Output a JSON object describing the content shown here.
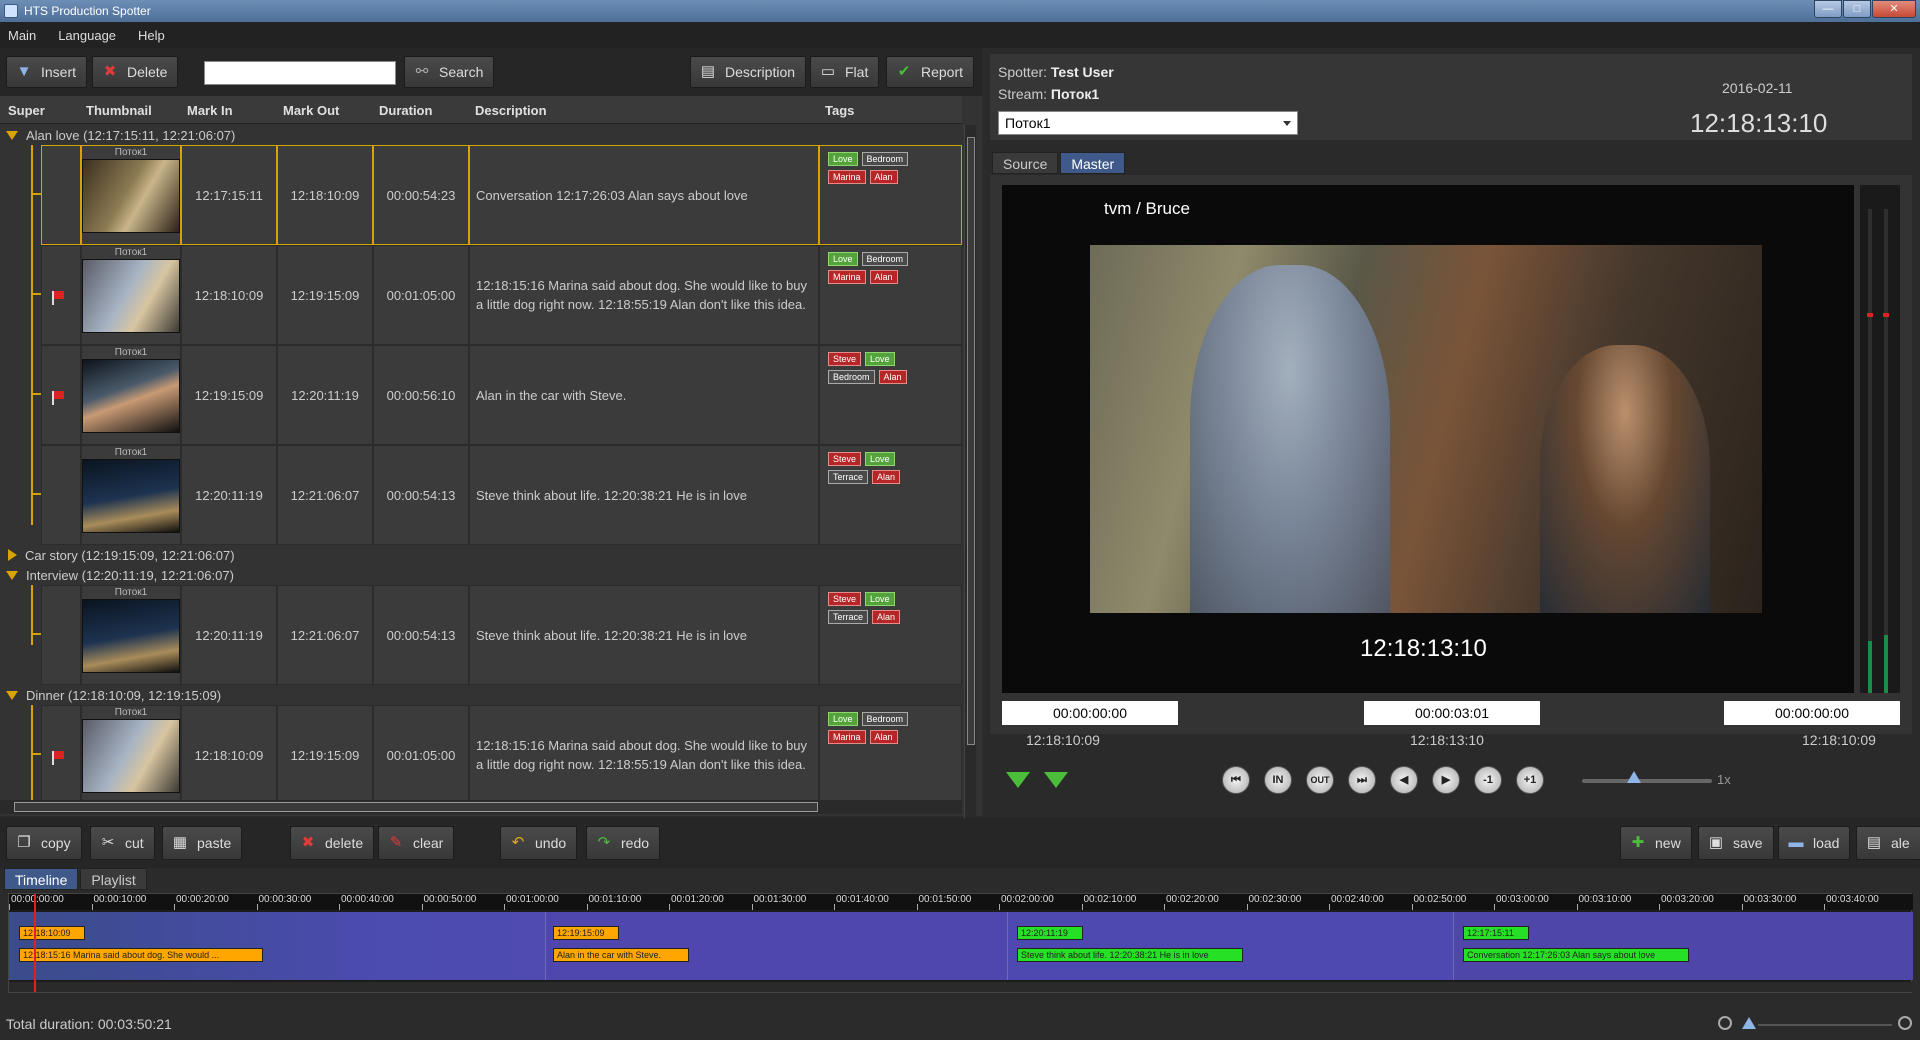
{
  "window": {
    "title": "HTS Production Spotter",
    "controls": [
      "—",
      "□",
      "✕"
    ]
  },
  "menu": [
    "Main",
    "Language",
    "Help"
  ],
  "toolbar": {
    "insert": "Insert",
    "delete": "Delete",
    "search_value": "",
    "search": "Search",
    "description": "Description",
    "flat": "Flat",
    "report": "Report"
  },
  "columns": [
    "Super",
    "Thumbnail",
    "Mark In",
    "Mark Out",
    "Duration",
    "Description",
    "Tags"
  ],
  "groups": [
    {
      "label": "Alan love (12:17:15:11, 12:21:06:07)",
      "open": true
    },
    {
      "label": "Car story (12:19:15:09, 12:21:06:07)",
      "open": false
    },
    {
      "label": "Interview (12:20:11:19, 12:21:06:07)",
      "open": true
    },
    {
      "label": "Dinner  (12:18:10:09, 12:19:15:09)",
      "open": true
    }
  ],
  "clips": [
    {
      "thumb_label": "Поток1",
      "mark_in": "12:17:15:11",
      "mark_out": "12:18:10:09",
      "duration": "00:00:54:23",
      "description": "Conversation 12:17:26:03 Alan says about love",
      "tags": [
        [
          "Love",
          "green"
        ],
        [
          "Bedroom",
          "gray"
        ],
        [
          "Marina",
          "red"
        ],
        [
          "Alan",
          "red"
        ]
      ],
      "flag": false,
      "selected": true
    },
    {
      "thumb_label": "Поток1",
      "mark_in": "12:18:10:09",
      "mark_out": "12:19:15:09",
      "duration": "00:01:05:00",
      "description": "12:18:15:16 Marina said about dog. She would like to buy a little dog right now. 12:18:55:19 Alan don't like this idea.",
      "tags": [
        [
          "Love",
          "green"
        ],
        [
          "Bedroom",
          "gray"
        ],
        [
          "Marina",
          "red"
        ],
        [
          "Alan",
          "red"
        ]
      ],
      "flag": true,
      "selected": false
    },
    {
      "thumb_label": "Поток1",
      "mark_in": "12:19:15:09",
      "mark_out": "12:20:11:19",
      "duration": "00:00:56:10",
      "description": "Alan in the car with Steve.",
      "tags": [
        [
          "Steve",
          "red"
        ],
        [
          "Love",
          "green"
        ],
        [
          "Bedroom",
          "gray"
        ],
        [
          "Alan",
          "red"
        ]
      ],
      "flag": true,
      "selected": false
    },
    {
      "thumb_label": "Поток1",
      "mark_in": "12:20:11:19",
      "mark_out": "12:21:06:07",
      "duration": "00:00:54:13",
      "description": "Steve think about life. 12:20:38:21 He is in love",
      "tags": [
        [
          "Steve",
          "red"
        ],
        [
          "Love",
          "green"
        ],
        [
          "Terrace",
          "gray"
        ],
        [
          "Alan",
          "red"
        ]
      ],
      "flag": false,
      "selected": false
    },
    {
      "thumb_label": "Поток1",
      "mark_in": "12:20:11:19",
      "mark_out": "12:21:06:07",
      "duration": "00:00:54:13",
      "description": "Steve think about life. 12:20:38:21 He is in love",
      "tags": [
        [
          "Steve",
          "red"
        ],
        [
          "Love",
          "green"
        ],
        [
          "Terrace",
          "gray"
        ],
        [
          "Alan",
          "red"
        ]
      ],
      "flag": false,
      "selected": false
    },
    {
      "thumb_label": "Поток1",
      "mark_in": "12:18:10:09",
      "mark_out": "12:19:15:09",
      "duration": "00:01:05:00",
      "description": "12:18:15:16 Marina said about dog. She would like to buy a little dog right now. 12:18:55:19 Alan don't like this idea.",
      "tags": [
        [
          "Love",
          "green"
        ],
        [
          "Bedroom",
          "gray"
        ],
        [
          "Marina",
          "red"
        ],
        [
          "Alan",
          "red"
        ]
      ],
      "flag": true,
      "selected": false
    }
  ],
  "spotter": {
    "spotter_label": "Spotter:",
    "spotter_name": "Test User",
    "stream_label": "Stream:",
    "stream_name": "Поток1",
    "stream_selected": "Поток1",
    "date": "2016-02-11",
    "clock": "12:18:13:10"
  },
  "video_tabs": [
    "Source",
    "Master"
  ],
  "video": {
    "channel": "tvm / Bruce",
    "timecode": "12:18:13:10",
    "tc_in": "00:00:00:00",
    "tc_mid": "00:00:03:01",
    "tc_out": "00:00:00:00",
    "label_left": "12:18:10:09",
    "label_mid": "12:18:13:10",
    "label_right": "12:18:10:09"
  },
  "transport": {
    "buttons": [
      "⏮",
      "IN",
      "OUT",
      "⏭",
      "◀",
      "▶",
      "-1",
      "+1"
    ],
    "speed_label": "1x",
    "speed_value": 0.4
  },
  "edit": {
    "copy": "copy",
    "cut": "cut",
    "paste": "paste",
    "delete": "delete",
    "clear": "clear",
    "undo": "undo",
    "redo": "redo",
    "new": "new",
    "save": "save",
    "load": "load",
    "ale": "ale"
  },
  "timeline_tabs": [
    "Timeline",
    "Playlist"
  ],
  "ruler": [
    "00:00:00:00",
    "00:00:10:00",
    "00:00:20:00",
    "00:00:30:00",
    "00:00:40:00",
    "00:00:50:00",
    "00:01:00:00",
    "00:01:10:00",
    "00:01:20:00",
    "00:01:30:00",
    "00:01:40:00",
    "00:01:50:00",
    "00:02:00:00",
    "00:02:10:00",
    "00:02:20:00",
    "00:02:30:00",
    "00:02:40:00",
    "00:02:50:00",
    "00:03:00:00",
    "00:03:10:00",
    "00:03:20:00",
    "00:03:30:00",
    "00:03:40:00"
  ],
  "timeline_clips": [
    {
      "start": "12:18:10:09",
      "desc": "12:18:15:16 Marina said about dog. She would ..."
    },
    {
      "start": "12:19:15:09",
      "desc": "Alan in the car with Steve."
    },
    {
      "start": "12:20:11:19",
      "desc": "Steve think about life. 12:20:38:21 He is in love"
    },
    {
      "start": "12:17:15:11",
      "desc": "Conversation 12:17:26:03 Alan says about love"
    }
  ],
  "status": {
    "total_duration": "Total duration: 00:03:50:21"
  }
}
